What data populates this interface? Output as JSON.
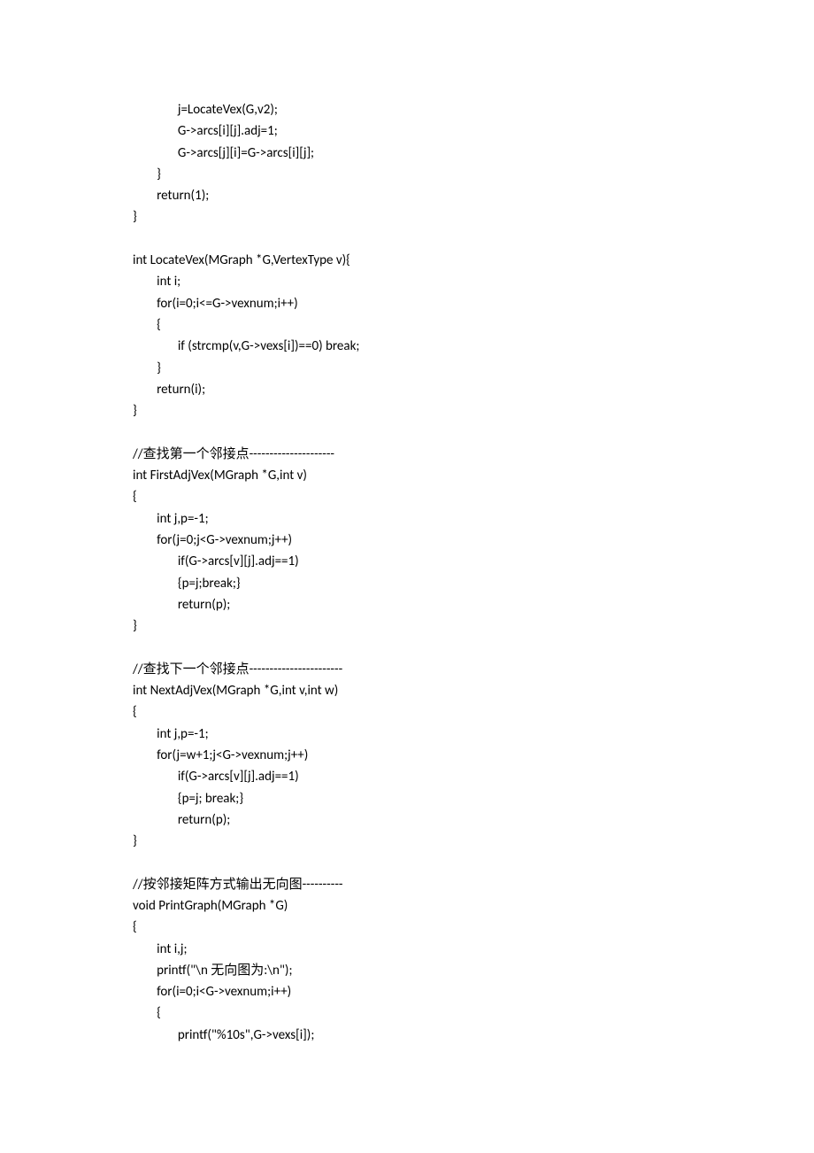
{
  "code_lines": [
    "               j=LocateVex(G,v2);",
    "               G->arcs[i][j].adj=1;",
    "               G->arcs[j][i]=G->arcs[i][j];",
    "        }",
    "        return(1);",
    "}",
    "",
    "int LocateVex(MGraph *G,VertexType v){",
    "        int i;",
    "        for(i=0;i<=G->vexnum;i++)",
    "        {",
    "               if (strcmp(v,G->vexs[i])==0) break;",
    "        }",
    "        return(i);",
    "}",
    "",
    "//查找第一个邻接点---------------------",
    "int FirstAdjVex(MGraph *G,int v)",
    "{",
    "        int j,p=-1;",
    "        for(j=0;j<G->vexnum;j++)",
    "               if(G->arcs[v][j].adj==1)",
    "               {p=j;break;}",
    "               return(p);",
    "}",
    "",
    "//查找下一个邻接点-----------------------",
    "int NextAdjVex(MGraph *G,int v,int w)",
    "{",
    "        int j,p=-1;",
    "        for(j=w+1;j<G->vexnum;j++)",
    "               if(G->arcs[v][j].adj==1)",
    "               {p=j; break;}",
    "               return(p);",
    "}",
    "",
    "//按邻接矩阵方式输出无向图----------",
    "void PrintGraph(MGraph *G)",
    "{",
    "        int i,j;",
    "        printf(\"\\n 无向图为:\\n\");",
    "        for(i=0;i<G->vexnum;i++)",
    "        {",
    "               printf(\"%10s\",G->vexs[i]);"
  ]
}
